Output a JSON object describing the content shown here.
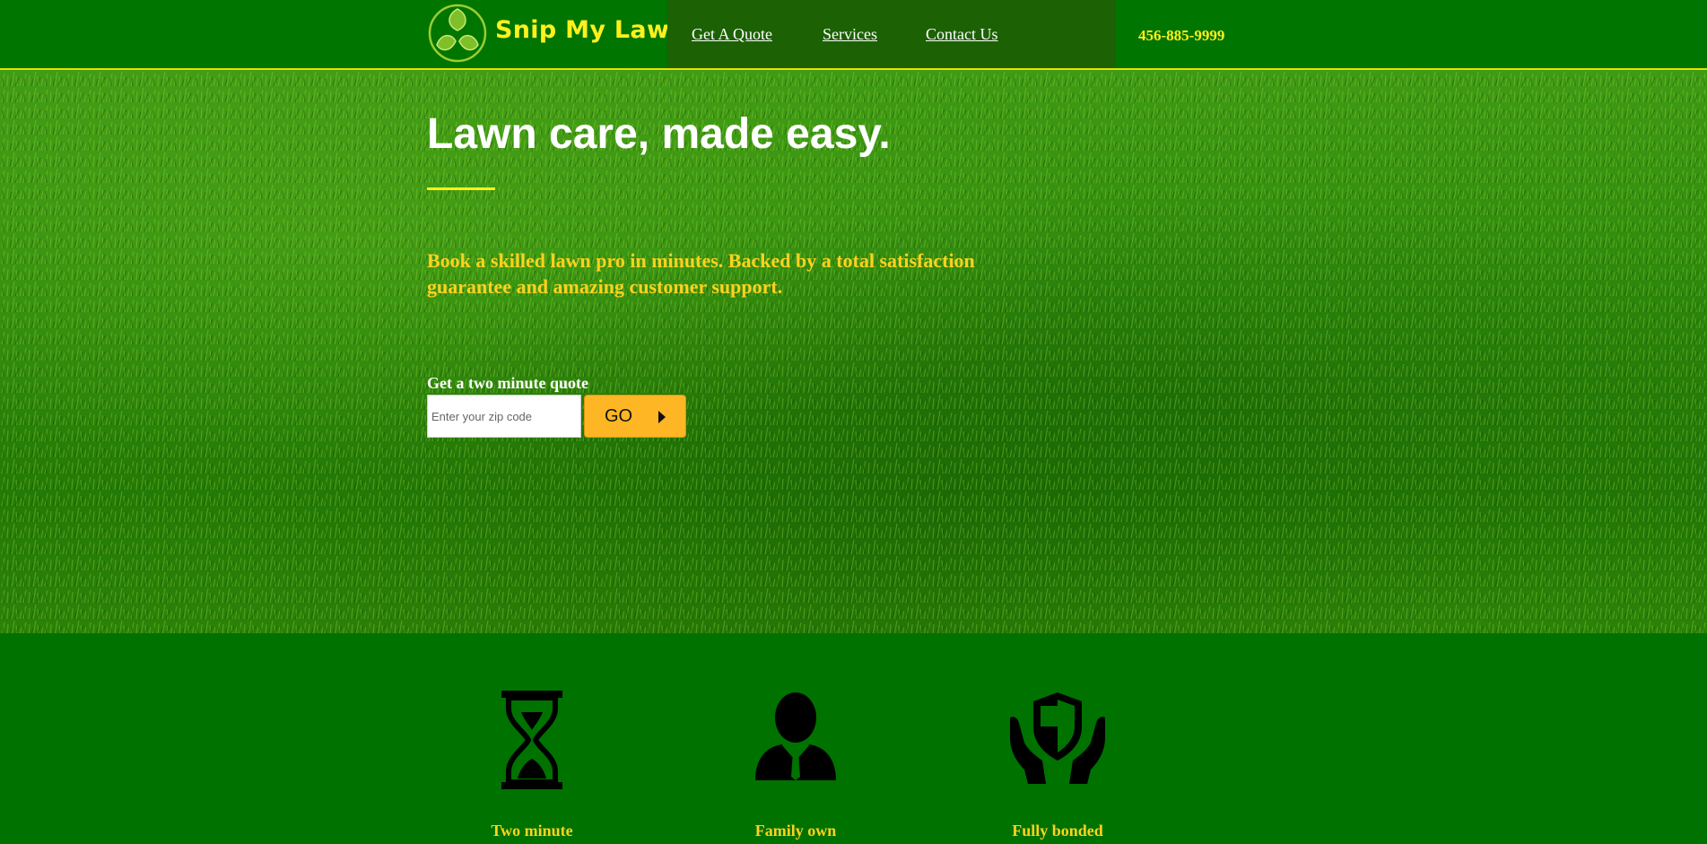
{
  "header": {
    "brand": "Snip My Lawn",
    "nav": [
      "Get A Quote",
      "Services",
      "Contact Us"
    ],
    "phone": "456-885-9999"
  },
  "hero": {
    "title": "Lawn care, made easy.",
    "subtitle": "Book a skilled lawn pro in minutes. Backed by a total satisfaction guarantee and amazing customer support.",
    "quote_label": "Get a two minute quote",
    "zip_placeholder": "Enter your zip code",
    "go_label": "GO"
  },
  "features": [
    {
      "icon": "hourglass-icon",
      "label": "Two minute"
    },
    {
      "icon": "person-icon",
      "label": "Family own"
    },
    {
      "icon": "shield-hands-icon",
      "label": "Fully bonded"
    }
  ],
  "colors": {
    "header_green": "#007500",
    "nav_dark_green": "#1c6104",
    "accent_yellow": "#fff01e",
    "gold": "#ffd21e",
    "button_orange": "#ffb624"
  }
}
